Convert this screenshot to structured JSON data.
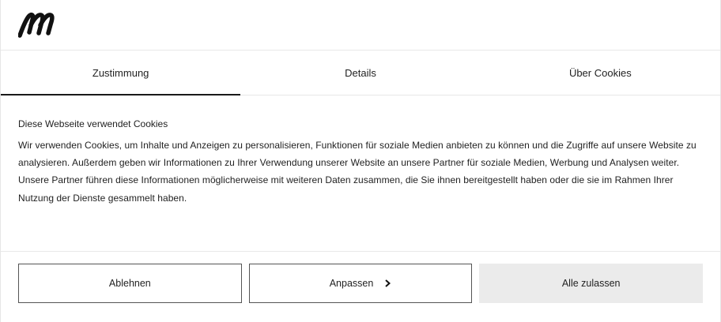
{
  "brand": {
    "logo_icon": "m-logo-icon"
  },
  "tabs": [
    {
      "label": "Zustimmung",
      "active": true
    },
    {
      "label": "Details",
      "active": false
    },
    {
      "label": "Über Cookies",
      "active": false
    }
  ],
  "content": {
    "title": "Diese Webseite verwendet Cookies",
    "body": "Wir verwenden Cookies, um Inhalte und Anzeigen zu personalisieren, Funktionen für soziale Medien anbieten zu können und die Zugriffe auf unsere Website zu analysieren. Außerdem geben wir Informationen zu Ihrer Verwendung unserer Website an unsere Partner für soziale Medien, Werbung und Analysen weiter. Unsere Partner führen diese Informationen möglicherweise mit weiteren Daten zusammen, die Sie ihnen bereitgestellt haben oder die sie im Rahmen Ihrer Nutzung der Dienste gesammelt haben."
  },
  "actions": {
    "decline_label": "Ablehnen",
    "customize_label": "Anpassen",
    "customize_icon": "chevron-right-icon",
    "accept_all_label": "Alle zulassen"
  },
  "colors": {
    "accent_text": "#222222",
    "primary_button_bg": "#ebebeb",
    "divider": "#e8e8e8"
  }
}
